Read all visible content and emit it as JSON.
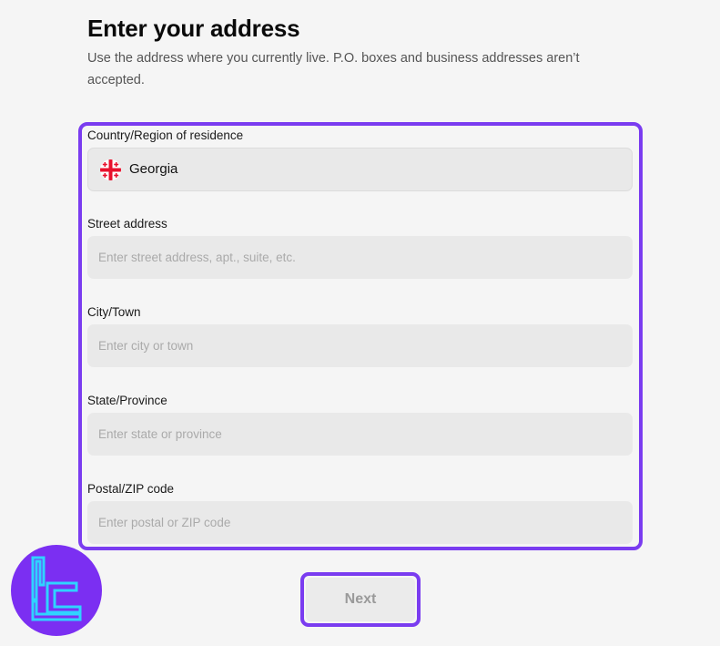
{
  "header": {
    "title": "Enter your address",
    "subtitle": "Use the address where you currently live. P.O. boxes and business addresses aren’t accepted."
  },
  "form": {
    "country": {
      "label": "Country/Region of residence",
      "value": "Georgia",
      "flag_icon": "georgia-flag-icon"
    },
    "street": {
      "label": "Street address",
      "placeholder": "Enter street address, apt., suite, etc.",
      "value": ""
    },
    "city": {
      "label": "City/Town",
      "placeholder": "Enter city or town",
      "value": ""
    },
    "state": {
      "label": "State/Province",
      "placeholder": "Enter state or province",
      "value": ""
    },
    "postal": {
      "label": "Postal/ZIP code",
      "placeholder": "Enter postal or ZIP code",
      "value": ""
    }
  },
  "actions": {
    "next_label": "Next"
  },
  "colors": {
    "highlight": "#7a3cf0",
    "field_bg": "#e9e9e9",
    "logo_bg": "#7b2ff2",
    "logo_stroke": "#2fd3ff"
  }
}
